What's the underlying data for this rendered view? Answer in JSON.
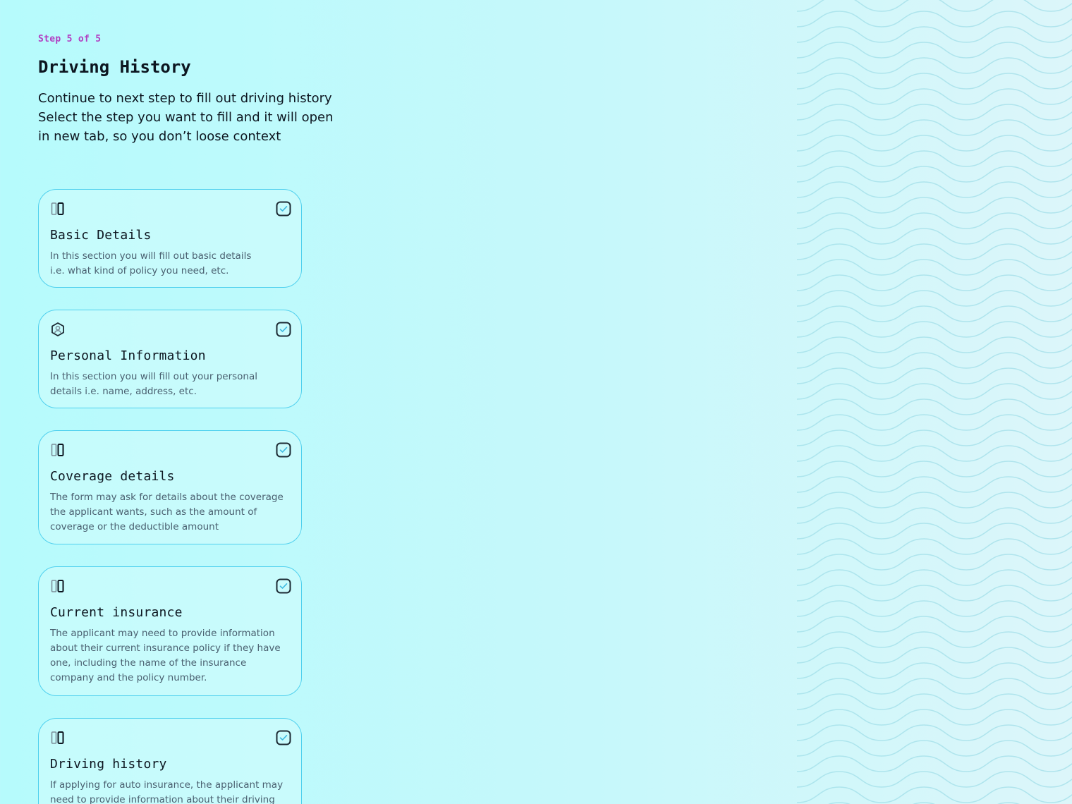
{
  "header": {
    "step_label": "Step 5 of 5",
    "title": "Driving History",
    "intro_lines": [
      "Continue to next step to fill out driving history",
      "Select the step you want to fill and it will open",
      "in new tab, so you don’t loose context"
    ]
  },
  "colors": {
    "accent": "#b23ec2",
    "card_border": "#4fd0ee",
    "check_tick": "#3bb8e0"
  },
  "steps": [
    {
      "icon": "columns-icon",
      "title": "Basic Details",
      "description_lines": [
        "In this section you will fill out basic details",
        "i.e. what kind of policy you need, etc."
      ],
      "checked": true
    },
    {
      "icon": "user-hexagon-icon",
      "title": "Personal Information",
      "description_lines": [
        "In this section you will fill out your personal",
        "details i.e. name, address, etc."
      ],
      "checked": true
    },
    {
      "icon": "columns-icon",
      "title": "Coverage details",
      "description_lines": [
        "The form may ask for details about the coverage",
        "the applicant wants, such as the amount of",
        "coverage or the deductible amount"
      ],
      "checked": true
    },
    {
      "icon": "columns-icon",
      "title": "Current insurance",
      "description_lines": [
        "The applicant may need to provide information",
        "about their current insurance policy if they have",
        "one, including the name of the insurance",
        "company and the policy number."
      ],
      "checked": true
    },
    {
      "icon": "columns-icon",
      "title": "Driving history",
      "description_lines": [
        "If applying for auto insurance, the applicant may",
        "need to provide information about their driving"
      ],
      "checked": true
    }
  ]
}
